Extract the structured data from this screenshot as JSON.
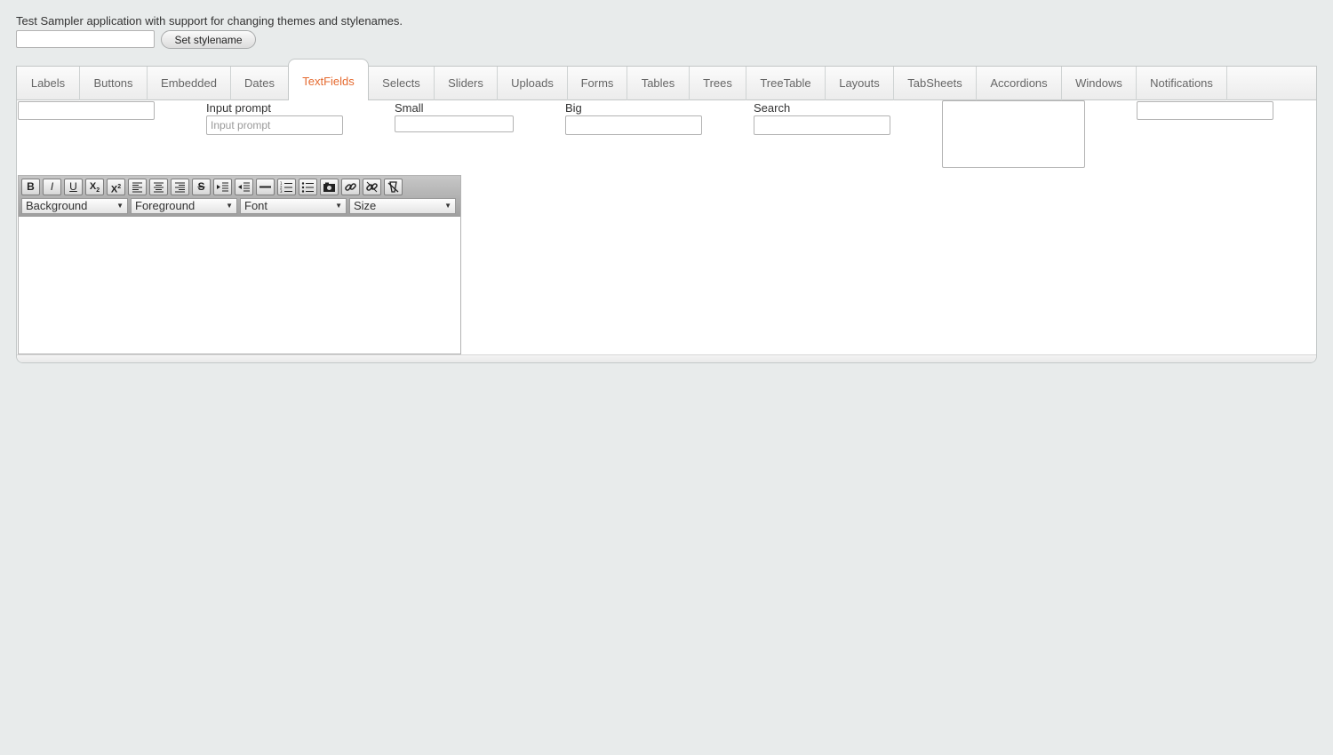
{
  "header": {
    "description": "Test Sampler application with support for changing themes and stylenames.",
    "stylename_value": "",
    "set_stylename_label": "Set stylename"
  },
  "tabs": [
    {
      "label": "Labels",
      "selected": false
    },
    {
      "label": "Buttons",
      "selected": false
    },
    {
      "label": "Embedded",
      "selected": false
    },
    {
      "label": "Dates",
      "selected": false
    },
    {
      "label": "TextFields",
      "selected": true
    },
    {
      "label": "Selects",
      "selected": false
    },
    {
      "label": "Sliders",
      "selected": false
    },
    {
      "label": "Uploads",
      "selected": false
    },
    {
      "label": "Forms",
      "selected": false
    },
    {
      "label": "Tables",
      "selected": false
    },
    {
      "label": "Trees",
      "selected": false
    },
    {
      "label": "TreeTable",
      "selected": false
    },
    {
      "label": "Layouts",
      "selected": false
    },
    {
      "label": "TabSheets",
      "selected": false
    },
    {
      "label": "Accordions",
      "selected": false
    },
    {
      "label": "Windows",
      "selected": false
    },
    {
      "label": "Notifications",
      "selected": false
    }
  ],
  "fields": {
    "input_prompt_label": "Input prompt",
    "input_prompt_placeholder": "Input prompt",
    "small_label": "Small",
    "big_label": "Big",
    "search_label": "Search"
  },
  "rich_text": {
    "buttons": [
      "bold-icon",
      "italic-icon",
      "underline-icon",
      "subscript-icon",
      "superscript-icon",
      "align-left-icon",
      "align-center-icon",
      "align-right-icon",
      "strikethrough-icon",
      "indent-icon",
      "outdent-icon",
      "horizontal-rule-icon",
      "ordered-list-icon",
      "unordered-list-icon",
      "insert-image-icon",
      "link-icon",
      "remove-link-icon",
      "remove-format-icon"
    ],
    "selects": {
      "background": "Background",
      "foreground": "Foreground",
      "font": "Font",
      "size": "Size"
    }
  },
  "colors": {
    "selected_tab_text": "#e56a2f",
    "background": "#e8ebeb"
  }
}
